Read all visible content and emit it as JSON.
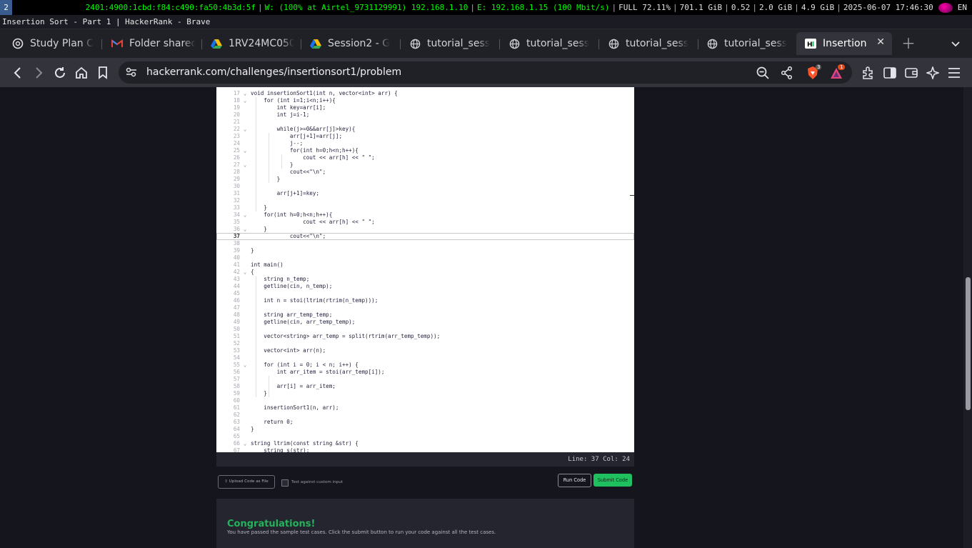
{
  "statusbar": {
    "workspace": "2",
    "ipv6": "2401:4900:1cbd:f84:c490:fa50:4b3d:5f",
    "wifi": "W: (100% at Airtel_9731129991) 192.168.1.10",
    "ethernet": "E: 192.168.1.15 (100 Mbit/s)",
    "battery": "FULL 72.11%",
    "disk": "701.1 GiB",
    "load": "0.52",
    "mem_used": "2.0 GiB",
    "mem_free": "4.9 GiB",
    "datetime": "2025-06-07 17:46:30",
    "lang": "EN"
  },
  "window_title": "Insertion Sort - Part 1 | HackerRank - Brave",
  "tabs": [
    {
      "label": "Study Plan C",
      "icon": "chatgpt-icon"
    },
    {
      "label": "Folder shared",
      "icon": "gmail-icon"
    },
    {
      "label": "1RV24MC050",
      "icon": "google-drive-icon"
    },
    {
      "label": "Session2 - G",
      "icon": "google-drive-icon"
    },
    {
      "label": "tutorial_sess",
      "icon": "globe-icon"
    },
    {
      "label": "tutorial_sess",
      "icon": "globe-icon"
    },
    {
      "label": "tutorial_sess",
      "icon": "globe-icon"
    },
    {
      "label": "tutorial_sess",
      "icon": "globe-icon"
    },
    {
      "label": "Insertion",
      "icon": "hackerrank-icon",
      "active": true
    }
  ],
  "toolbar": {
    "url": "hackerrank.com/challenges/insertionsort1/problem",
    "shields_count": "3",
    "rewards_count": "1"
  },
  "editor": {
    "current_line": 37,
    "lines": [
      {
        "n": "17",
        "fold": "⌄",
        "code": "void insertionSort1(int n, vector<int> arr) {"
      },
      {
        "n": "18",
        "fold": "⌄",
        "code": "    for (int i=1;i<n;i++){"
      },
      {
        "n": "19",
        "fold": "",
        "code": "        int key=arr[i];"
      },
      {
        "n": "20",
        "fold": "",
        "code": "        int j=i-1;"
      },
      {
        "n": "21",
        "fold": "",
        "code": ""
      },
      {
        "n": "22",
        "fold": "⌄",
        "code": "        while(j>=0&&arr[j]>key){"
      },
      {
        "n": "23",
        "fold": "",
        "code": "            arr[j+1]=arr[j];"
      },
      {
        "n": "24",
        "fold": "",
        "code": "            j--;"
      },
      {
        "n": "25",
        "fold": "⌄",
        "code": "            for(int h=0;h<n;h++){"
      },
      {
        "n": "26",
        "fold": "",
        "code": "                cout << arr[h] << \" \";"
      },
      {
        "n": "27",
        "fold": "⌄",
        "code": "            }"
      },
      {
        "n": "28",
        "fold": "",
        "code": "            cout<<\"\\n\";"
      },
      {
        "n": "29",
        "fold": "",
        "code": "        }"
      },
      {
        "n": "30",
        "fold": "",
        "code": ""
      },
      {
        "n": "31",
        "fold": "",
        "code": "        arr[j+1]=key;"
      },
      {
        "n": "32",
        "fold": "",
        "code": ""
      },
      {
        "n": "33",
        "fold": "",
        "code": "    }"
      },
      {
        "n": "34",
        "fold": "⌄",
        "code": "    for(int h=0;h<n;h++){"
      },
      {
        "n": "35",
        "fold": "",
        "code": "                cout << arr[h] << \" \";"
      },
      {
        "n": "36",
        "fold": "⌄",
        "code": "    }"
      },
      {
        "n": "37",
        "fold": "",
        "code": "            cout<<\"\\n\";"
      },
      {
        "n": "38",
        "fold": "",
        "code": ""
      },
      {
        "n": "39",
        "fold": "",
        "code": "}"
      },
      {
        "n": "40",
        "fold": "",
        "code": ""
      },
      {
        "n": "41",
        "fold": "",
        "code": "int main()"
      },
      {
        "n": "42",
        "fold": "⌄",
        "code": "{"
      },
      {
        "n": "43",
        "fold": "",
        "code": "    string n_temp;"
      },
      {
        "n": "44",
        "fold": "",
        "code": "    getline(cin, n_temp);"
      },
      {
        "n": "45",
        "fold": "",
        "code": ""
      },
      {
        "n": "46",
        "fold": "",
        "code": "    int n = stoi(ltrim(rtrim(n_temp)));"
      },
      {
        "n": "47",
        "fold": "",
        "code": ""
      },
      {
        "n": "48",
        "fold": "",
        "code": "    string arr_temp_temp;"
      },
      {
        "n": "49",
        "fold": "",
        "code": "    getline(cin, arr_temp_temp);"
      },
      {
        "n": "50",
        "fold": "",
        "code": ""
      },
      {
        "n": "51",
        "fold": "",
        "code": "    vector<string> arr_temp = split(rtrim(arr_temp_temp));"
      },
      {
        "n": "52",
        "fold": "",
        "code": ""
      },
      {
        "n": "53",
        "fold": "",
        "code": "    vector<int> arr(n);"
      },
      {
        "n": "54",
        "fold": "",
        "code": ""
      },
      {
        "n": "55",
        "fold": "⌄",
        "code": "    for (int i = 0; i < n; i++) {"
      },
      {
        "n": "56",
        "fold": "",
        "code": "        int arr_item = stoi(arr_temp[i]);"
      },
      {
        "n": "57",
        "fold": "",
        "code": ""
      },
      {
        "n": "58",
        "fold": "",
        "code": "        arr[i] = arr_item;"
      },
      {
        "n": "59",
        "fold": "",
        "code": "    }"
      },
      {
        "n": "60",
        "fold": "",
        "code": ""
      },
      {
        "n": "61",
        "fold": "",
        "code": "    insertionSort1(n, arr);"
      },
      {
        "n": "62",
        "fold": "",
        "code": ""
      },
      {
        "n": "63",
        "fold": "",
        "code": "    return 0;"
      },
      {
        "n": "64",
        "fold": "",
        "code": "}"
      },
      {
        "n": "65",
        "fold": "",
        "code": ""
      },
      {
        "n": "66",
        "fold": "⌄",
        "code": "string ltrim(const string &str) {"
      },
      {
        "n": "67",
        "fold": "",
        "code": "    string s(str);"
      }
    ]
  },
  "editor_status": "Line: 37 Col: 24",
  "actions": {
    "upload_label": "Upload Code as File",
    "custom_input_label": "Test against custom input",
    "run_label": "Run Code",
    "submit_label": "Submit Code"
  },
  "result": {
    "title": "Congratulations!",
    "message": "You have passed the sample test cases. Click the submit button to run your code against all the test cases."
  },
  "scroll_position": 0.58,
  "colors": {
    "accent_green": "#1ec05f",
    "success_text": "#23b35a"
  }
}
